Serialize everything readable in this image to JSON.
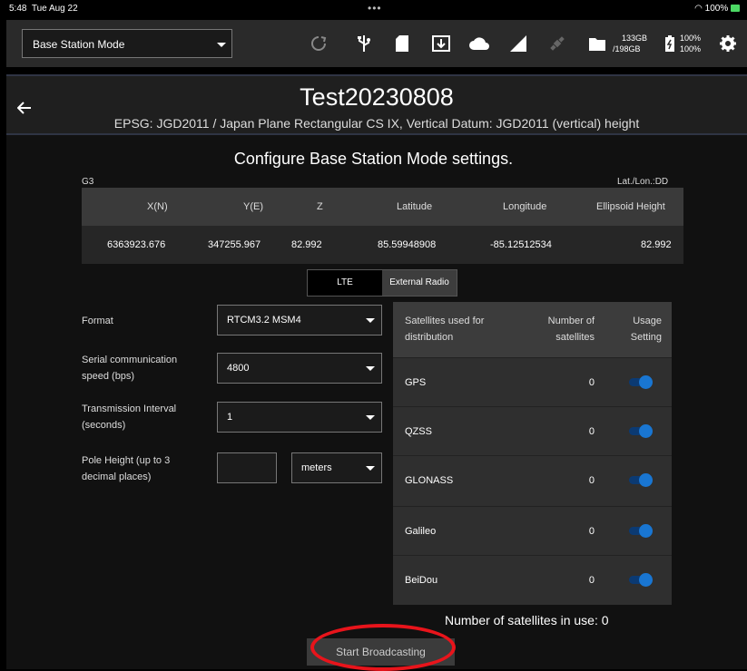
{
  "status_bar": {
    "time": "5:48",
    "date": "Tue Aug 22",
    "dots": "•••",
    "battery": "100%"
  },
  "toolbar": {
    "mode_select": "Base Station Mode",
    "storage": {
      "used": "133GB",
      "total": "/198GB"
    },
    "battery": {
      "line1": "100%",
      "line2": "100%"
    },
    "icons": [
      "refresh-icon",
      "usb-icon",
      "sd-card-icon",
      "download-box-icon",
      "cloud-icon",
      "signal-icon",
      "satellite-icon",
      "folder-icon",
      "battery-icon",
      "gear-icon"
    ]
  },
  "header": {
    "title": "Test20230808",
    "subtitle": "EPSG: JGD2011 / Japan Plane Rectangular CS IX, Vertical Datum: JGD2011 (vertical) height"
  },
  "config_title": "Configure Base Station Mode settings.",
  "grid_label": "G3",
  "latlon_format": "Lat./Lon.:DD",
  "coordinates": {
    "headers": [
      "X(N)",
      "Y(E)",
      "Z",
      "Latitude",
      "Longitude",
      "Ellipsoid Height"
    ],
    "values": [
      "6363923.676",
      "347255.967",
      "82.992",
      "85.59948908",
      "-85.12512534",
      "82.992"
    ]
  },
  "segments": {
    "lte": "LTE",
    "external": "External Radio",
    "selected": "External Radio"
  },
  "form": {
    "format": {
      "label": "Format",
      "value": "RTCM3.2 MSM4"
    },
    "speed": {
      "label1": "Serial communication",
      "label2": "speed (bps)",
      "value": "4800"
    },
    "interval": {
      "label1": "Transmission Interval",
      "label2": "(seconds)",
      "value": "1"
    },
    "pole": {
      "label1": "Pole Height (up to 3",
      "label2": "decimal places)",
      "value": "",
      "unit": "meters"
    }
  },
  "satellites": {
    "headers": {
      "col1_line1": "Satellites used for",
      "col1_line2": "distribution",
      "col2_line1": "Number of",
      "col2_line2": "satellites",
      "col3_line1": "Usage",
      "col3_line2": "Setting"
    },
    "rows": [
      {
        "name": "GPS",
        "count": "0",
        "enabled": true
      },
      {
        "name": "QZSS",
        "count": "0",
        "enabled": true
      },
      {
        "name": "GLONASS",
        "count": "0",
        "enabled": true
      },
      {
        "name": "Galileo",
        "count": "0",
        "enabled": true
      },
      {
        "name": "BeiDou",
        "count": "0",
        "enabled": true
      }
    ]
  },
  "in_use_text": "Number of satellites in use: 0",
  "start_button": "Start Broadcasting",
  "colors": {
    "accent": "#1976d2",
    "annotation": "#e8141b"
  }
}
